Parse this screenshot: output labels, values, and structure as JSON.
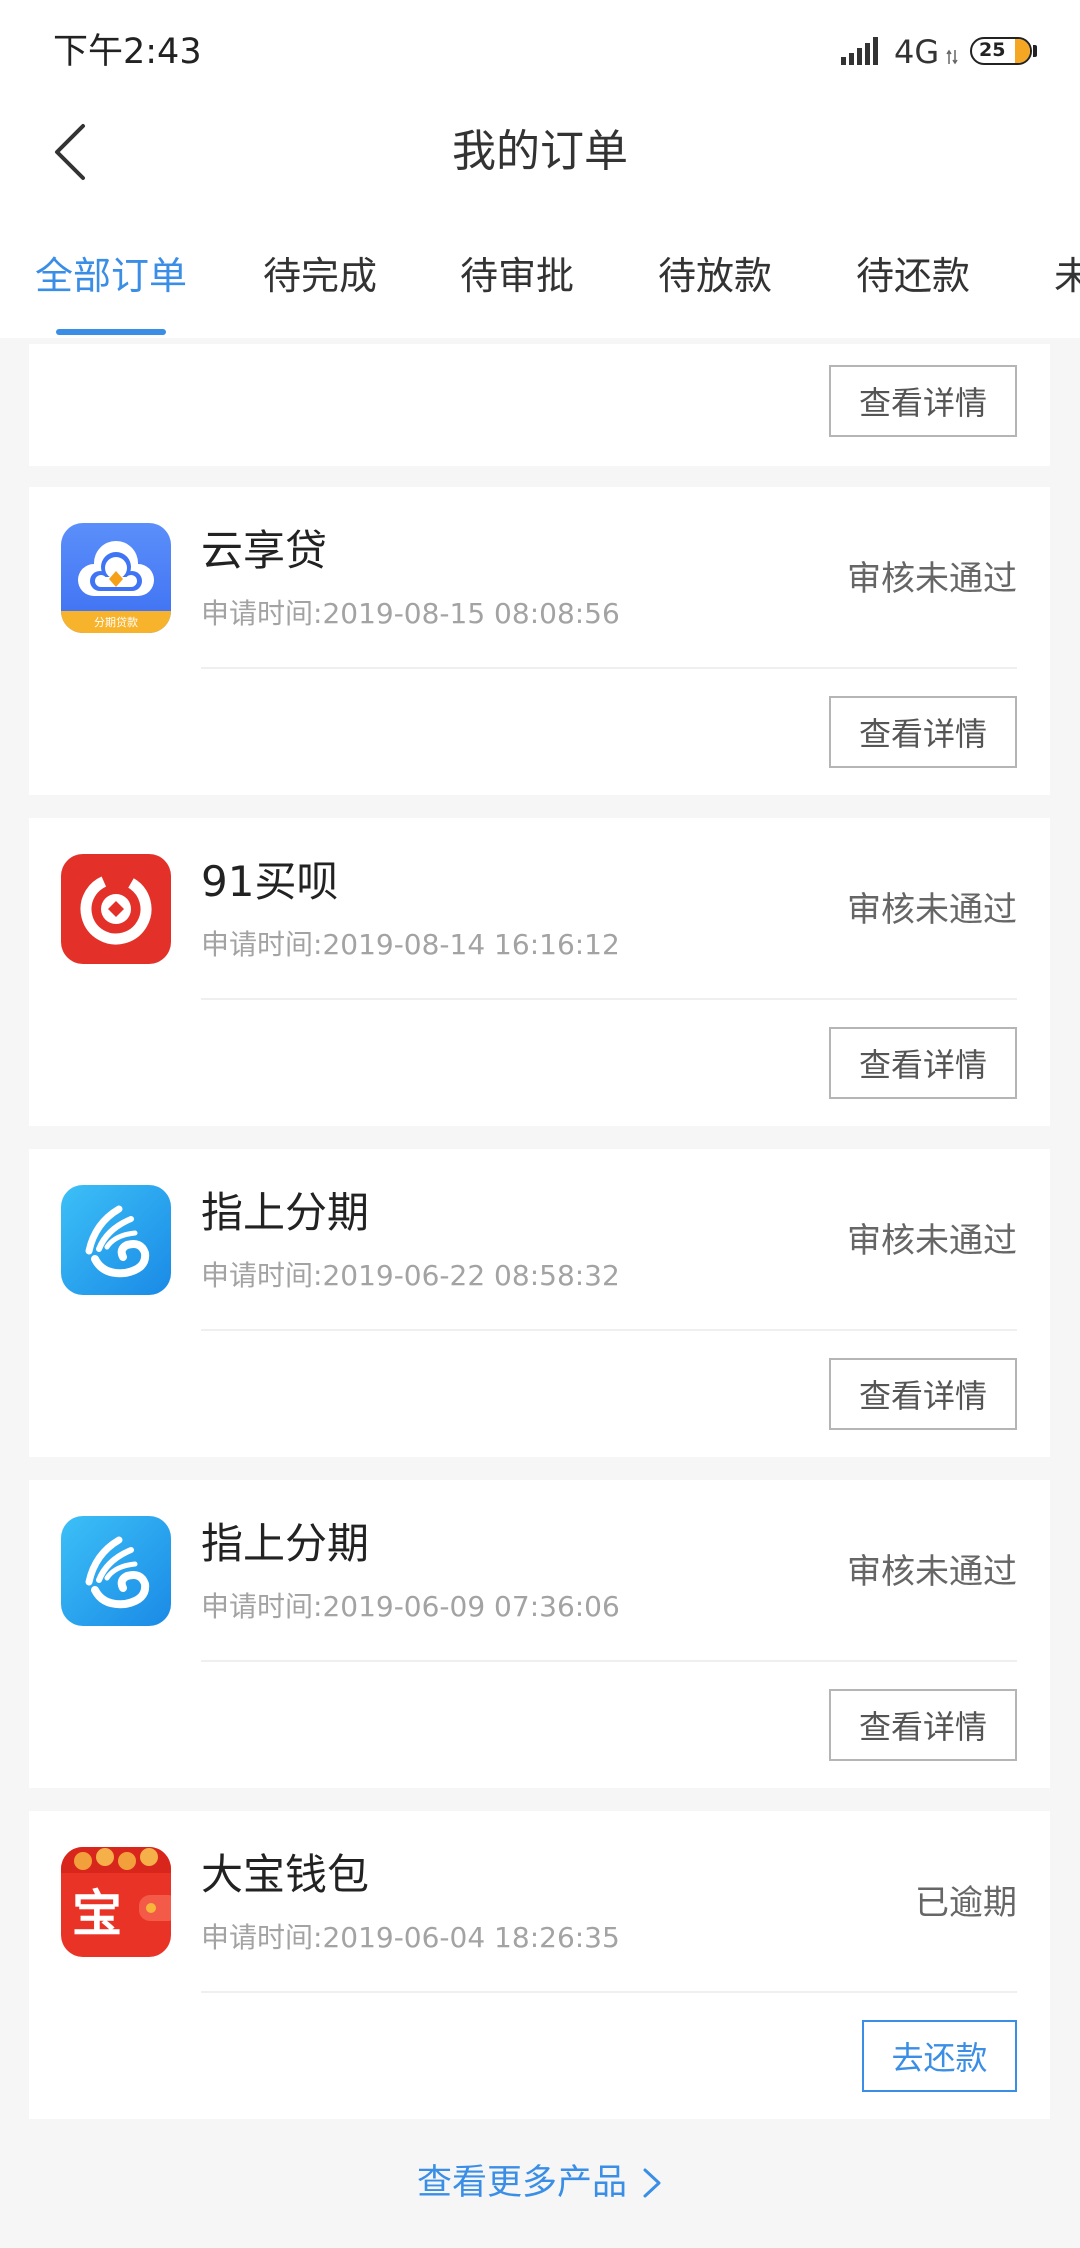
{
  "status_bar": {
    "time": "下午2:43",
    "network": "4G",
    "battery_level": "25",
    "icons": [
      "signal-icon",
      "data-arrows-icon",
      "battery-icon"
    ]
  },
  "header": {
    "back_icon": "back-arrow-icon",
    "title": "我的订单"
  },
  "tabs": [
    {
      "label": "全部订单",
      "active": true
    },
    {
      "label": "待完成",
      "active": false
    },
    {
      "label": "待审批",
      "active": false
    },
    {
      "label": "待放款",
      "active": false
    },
    {
      "label": "待还款",
      "active": false
    },
    {
      "label": "未",
      "active": false
    }
  ],
  "apply_time_label": "申请时间:",
  "orders": [
    {
      "action_label": "查看详情"
    },
    {
      "name": "云享贷",
      "apply_time": "2019-08-15 08:08:56",
      "status": "审核未通过",
      "action_label": "查看详情",
      "logo": "yunxiangdai-logo",
      "logo_text": "分期贷款"
    },
    {
      "name": "91买呗",
      "apply_time": "2019-08-14 16:16:12",
      "status": "审核未通过",
      "action_label": "查看详情",
      "logo": "91maibei-logo"
    },
    {
      "name": "指上分期",
      "apply_time": "2019-06-22 08:58:32",
      "status": "审核未通过",
      "action_label": "查看详情",
      "logo": "zhishangfenqi-logo"
    },
    {
      "name": "指上分期",
      "apply_time": "2019-06-09 07:36:06",
      "status": "审核未通过",
      "action_label": "查看详情",
      "logo": "zhishangfenqi-logo"
    },
    {
      "name": "大宝钱包",
      "apply_time": "2019-06-04 18:26:35",
      "status": "已逾期",
      "action_label": "去还款",
      "logo": "dabaoqianbao-logo",
      "logo_text": "宝"
    }
  ],
  "footer": {
    "more_label": "查看更多产品",
    "more_icon": "chevron-right-icon"
  },
  "colors": {
    "accent": "#3a8ee6",
    "background": "#f6f6f6",
    "card": "#ffffff",
    "status_text": "#666666",
    "secondary_text": "#a3a3a3",
    "battery_fill": "#f5a623"
  }
}
